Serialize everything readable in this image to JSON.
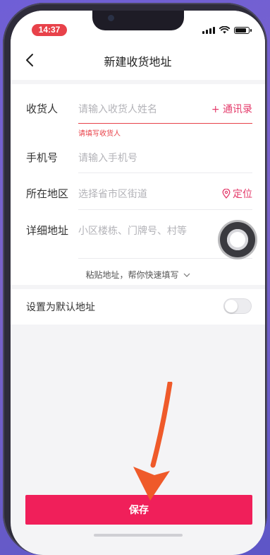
{
  "status_bar": {
    "time": "14:37"
  },
  "nav": {
    "title": "新建收货地址"
  },
  "form": {
    "recipient": {
      "label": "收货人",
      "placeholder": "请输入收货人姓名",
      "action": "+ 通讯录",
      "error": "请填写收货人"
    },
    "phone": {
      "label": "手机号",
      "placeholder": "请输入手机号"
    },
    "region": {
      "label": "所在地区",
      "placeholder": "选择省市区街道",
      "action": "定位"
    },
    "detail": {
      "label": "详细地址",
      "placeholder": "小区楼栋、门牌号、村等"
    },
    "paste_hint": "粘贴地址，帮你快速填写"
  },
  "default_address": {
    "label": "设置为默认地址",
    "enabled": false
  },
  "save_button": {
    "label": "保存"
  },
  "colors": {
    "accent": "#f01f5a",
    "error": "#e8424a",
    "time_pill": "#e8424a",
    "annotation_arrow": "#ef5a2a"
  },
  "icons": [
    "back-chevron-icon",
    "location-pin-icon",
    "chevron-down-icon",
    "assistive-touch-icon",
    "wifi-icon",
    "signal-icon",
    "battery-icon"
  ]
}
